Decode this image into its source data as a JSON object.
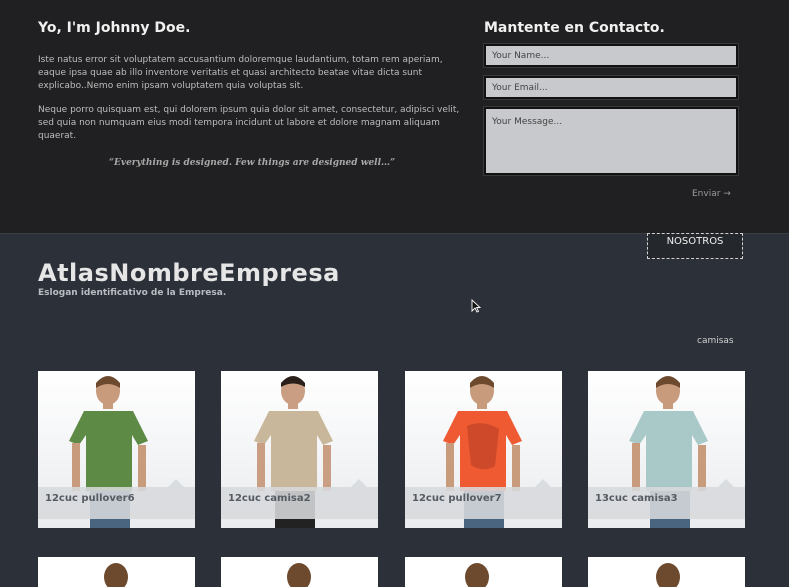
{
  "about": {
    "title": "Yo, I'm Johnny Doe.",
    "paragraph1": "Iste natus error sit voluptatem accusantium doloremque laudantium, totam rem aperiam, eaque ipsa quae ab illo inventore veritatis et quasi architecto beatae vitae dicta sunt explicabo..Nemo enim ipsam voluptatem quia voluptas sit.",
    "paragraph2": "Neque porro quisquam est, qui dolorem ipsum quia dolor sit amet, consectetur, adipisci velit, sed quia non numquam eius modi tempora incidunt ut labore et dolore magnam aliquam quaerat.",
    "quote": "“Everything is designed. Few things are designed well…”"
  },
  "contact": {
    "title": "Mantente en Contacto.",
    "name_placeholder": "Your Name...",
    "email_placeholder": "Your Email...",
    "message_placeholder": "Your Message...",
    "send_label": "Enviar →"
  },
  "nav": {
    "tab_label": "NOSOTROS"
  },
  "brand": {
    "name": "AtlasNombreEmpresa",
    "slogan": "Eslogan identificativo de la Empresa."
  },
  "filter": {
    "label": "camisas"
  },
  "products": [
    {
      "label": "12cuc pullover6",
      "shirt_color": "#5d8a45"
    },
    {
      "label": "12cuc camisa2",
      "shirt_color": "#c9b79c"
    },
    {
      "label": "12cuc pullover7",
      "shirt_color": "#f05a32"
    },
    {
      "label": "13cuc camisa3",
      "shirt_color": "#a9c9c9"
    }
  ]
}
